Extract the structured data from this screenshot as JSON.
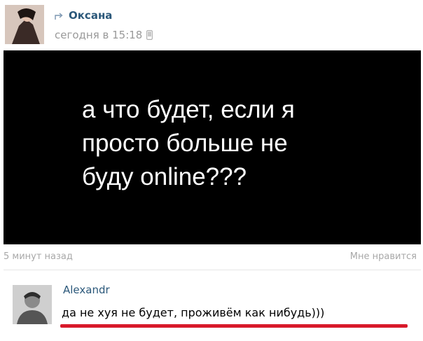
{
  "post": {
    "author": "Оксана",
    "timestamp": "сегодня в 15:18",
    "image_text": {
      "line1": "а что будет, если я",
      "line2": "просто больше не",
      "line3": "буду online???"
    },
    "posted_ago": "5 минут назад",
    "like_label": "Мне нравится"
  },
  "comment": {
    "author": "Alexandr",
    "text": "да не хуя не будет, проживём как нибудь)))",
    "underline_color": "#d8192a"
  },
  "colors": {
    "link": "#2b587a",
    "muted": "#999999",
    "image_bg": "#000000"
  },
  "icons": {
    "share": "share-arrow-icon",
    "phone": "phone-icon"
  }
}
